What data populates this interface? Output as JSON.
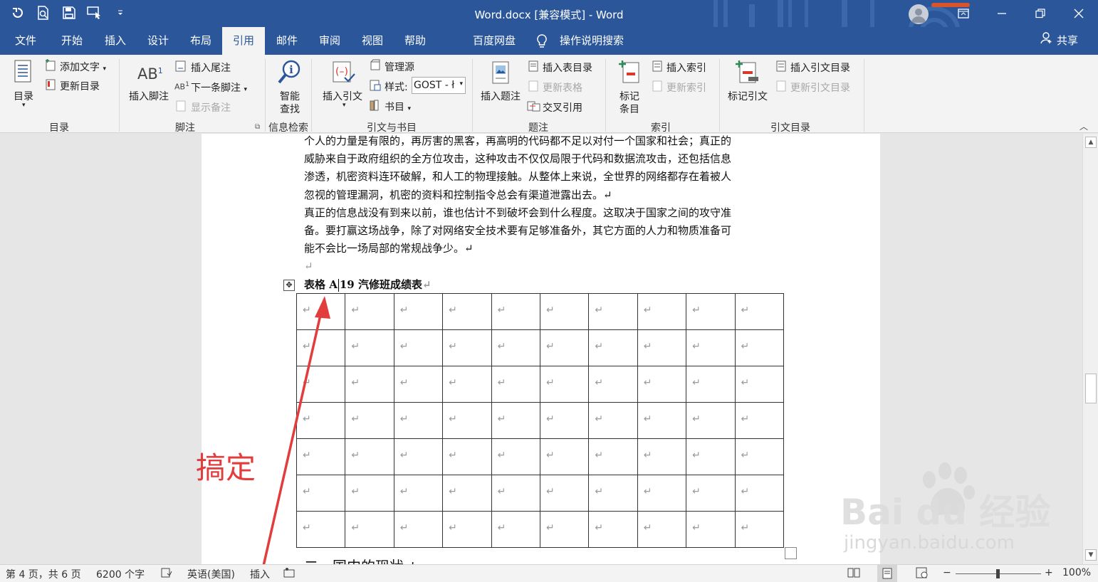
{
  "window": {
    "title": "Word.docx [兼容模式]  -  Word",
    "minimize_icon": "minimize-icon",
    "restore_icon": "restore-icon",
    "close_icon": "close-icon",
    "accent": "#2b579a"
  },
  "qat": {
    "items": [
      "undo-icon",
      "print-preview-icon",
      "save-icon",
      "touch-mode-icon",
      "customize-dropdown-icon"
    ]
  },
  "tabs": [
    {
      "label": "文件"
    },
    {
      "label": "开始"
    },
    {
      "label": "插入"
    },
    {
      "label": "设计"
    },
    {
      "label": "布局"
    },
    {
      "label": "引用"
    },
    {
      "label": "邮件"
    },
    {
      "label": "审阅"
    },
    {
      "label": "视图"
    },
    {
      "label": "帮助"
    },
    {
      "label": "百度网盘"
    },
    {
      "label": "操作说明搜索"
    }
  ],
  "active_tab": "引用",
  "share_label": "共享",
  "ribbon": {
    "toc": {
      "group": "目录",
      "toc_label": "目录",
      "add_text": "添加文字",
      "update_toc": "更新目录"
    },
    "footnotes": {
      "group": "脚注",
      "insert_footnote": "插入脚注",
      "insert_endnote": "插入尾注",
      "next_footnote": "下一条脚注",
      "show_notes": "显示备注"
    },
    "research": {
      "group": "信息检索",
      "smart_lookup_1": "智能",
      "smart_lookup_2": "查找"
    },
    "citations": {
      "group": "引文与书目",
      "insert_citation": "插入引文",
      "manage_sources": "管理源",
      "style_label": "样式:",
      "style_value": "GOST - ł",
      "bibliography": "书目"
    },
    "captions": {
      "group": "题注",
      "insert_caption": "插入题注",
      "insert_table_of_figures": "插入表目录",
      "update_table": "更新表格",
      "cross_reference": "交叉引用"
    },
    "index": {
      "group": "索引",
      "mark_entry_1": "标记",
      "mark_entry_2": "条目",
      "insert_index": "插入索引",
      "update_index": "更新索引"
    },
    "authorities": {
      "group": "引文目录",
      "mark_citation": "标记引文",
      "insert_toa": "插入引文目录",
      "update_toa": "更新引文目录"
    }
  },
  "document": {
    "lines_p1": [
      "个人的力量是有限的，再厉害的黑客，再高明的代码都不足以对付一个国家和社会；真正的",
      "威胁来自于政府组织的全方位攻击，这种攻击不仅仅局限于代码和数据流攻击，还包括信息",
      "渗透，机密资料连环破解，和人工的物理接触。从整体上来说，全世界的网络都存在着被人",
      "忽视的管理漏洞，机密的资料和控制指令总会有渠道泄露出去。↵"
    ],
    "lines_p2": [
      "真正的信息战没有到来以前，谁也估计不到破坏会到什么程度。这取决于国家之间的攻守准",
      "备。要打赢这场战争，除了对网络安全技术要有足够准备外，其它方面的人力和物质准备可",
      "能不会比一场局部的常规战争少。↵"
    ],
    "empty_mark": "↵",
    "caption_prefix": "表格  A",
    "caption_rest": "19 汽修班成绩表",
    "caption_mark": "↵",
    "table": {
      "rows": 7,
      "cols": 10,
      "cell_mark": "↵"
    },
    "next_heading": "二、国内的现状↵"
  },
  "annotation": {
    "text": "搞定",
    "color": "#e23c3c"
  },
  "watermark": {
    "brand": "Bai du 经验",
    "url": "jingyan.baidu.com"
  },
  "statusbar": {
    "page": "第 4 页，共 6 页",
    "words": "6200 个字",
    "language": "英语(美国)",
    "mode": "插入",
    "zoom": "100%",
    "zoom_minus": "−",
    "zoom_plus": "+"
  }
}
